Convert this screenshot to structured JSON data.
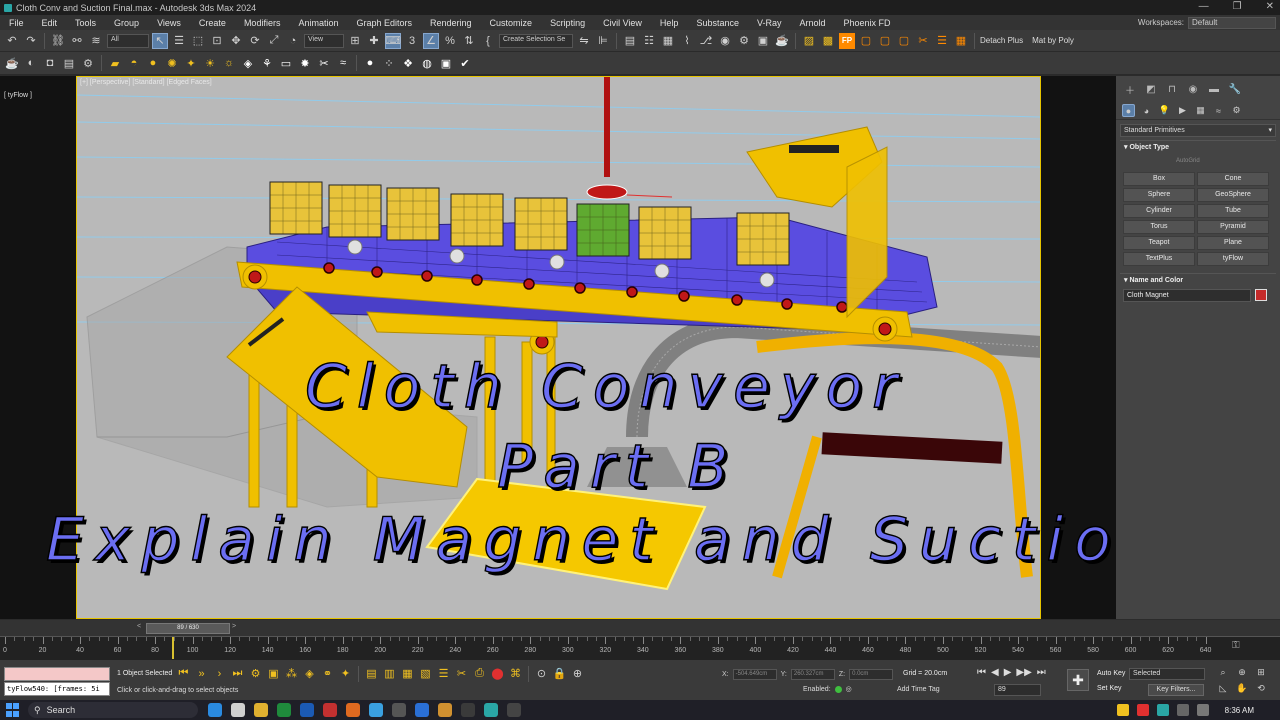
{
  "window": {
    "title": "Cloth Conv and Suction Final.max - Autodesk 3ds Max 2024",
    "controls": [
      "—",
      "❐",
      "✕"
    ]
  },
  "menu": {
    "items": [
      "File",
      "Edit",
      "Tools",
      "Group",
      "Views",
      "Create",
      "Modifiers",
      "Animation",
      "Graph Editors",
      "Rendering",
      "Customize",
      "Scripting",
      "Civil View",
      "Help",
      "Substance",
      "V-Ray",
      "Arnold",
      "Phoenix FD"
    ],
    "workspaces_label": "Workspaces:",
    "workspace_value": "Default"
  },
  "toolbar": {
    "filter_value": "All",
    "refcoord_value": "View",
    "selection_set_value": "Create Selection Se",
    "detach_plus": "Detach Plus",
    "mat_by_poly": "Mat by Poly"
  },
  "viewport": {
    "label": "[+] [Perspective] [Standard] [Edged Faces]",
    "sublabel": "[ tyFlow ]"
  },
  "overlay": {
    "line1": "Cloth Conveyor",
    "line2": "Part B",
    "line3": "Explain Magnet and Suction"
  },
  "command_panel": {
    "category": "Standard Primitives",
    "object_type_header": "Object Type",
    "autogrid": "AutoGrid",
    "objects": [
      "Box",
      "Cone",
      "Sphere",
      "GeoSphere",
      "Cylinder",
      "Tube",
      "Torus",
      "Pyramid",
      "Teapot",
      "Plane",
      "TextPlus",
      "tyFlow"
    ],
    "name_color_header": "Name and Color",
    "object_name": "Cloth Magnet",
    "object_color": "#c42a2a"
  },
  "timeline": {
    "frame_display": "89 / 630",
    "current_frame": 89,
    "total_frames": 630,
    "tick_labels": [
      "0",
      "20",
      "40",
      "60",
      "80",
      "100",
      "120",
      "140",
      "160",
      "180",
      "200",
      "220",
      "240",
      "260",
      "280",
      "300",
      "320",
      "340",
      "360",
      "380",
      "400",
      "420",
      "440",
      "460",
      "480",
      "500",
      "520",
      "540",
      "560",
      "580",
      "600",
      "620",
      "640"
    ]
  },
  "status": {
    "maxscript_log": "tyFlow540: [frames: 5i",
    "selection_count": "1 Object Selected",
    "hint": "Click or click-and-drag to select objects",
    "x_label": "X:",
    "x_value": "-504.649cm",
    "y_label": "Y:",
    "y_value": "260.327cm",
    "z_label": "Z:",
    "z_value": "0.0cm",
    "grid": "Grid = 20.0cm",
    "enabled": "Enabled:",
    "add_time_tag": "Add Time Tag",
    "frame_field": "89",
    "auto_key": "Auto Key",
    "set_key": "Set Key",
    "selected_dropdown": "Selected",
    "key_filters": "Key Filters..."
  },
  "taskbar": {
    "search_placeholder": "Search",
    "clock": "8:36 AM"
  }
}
